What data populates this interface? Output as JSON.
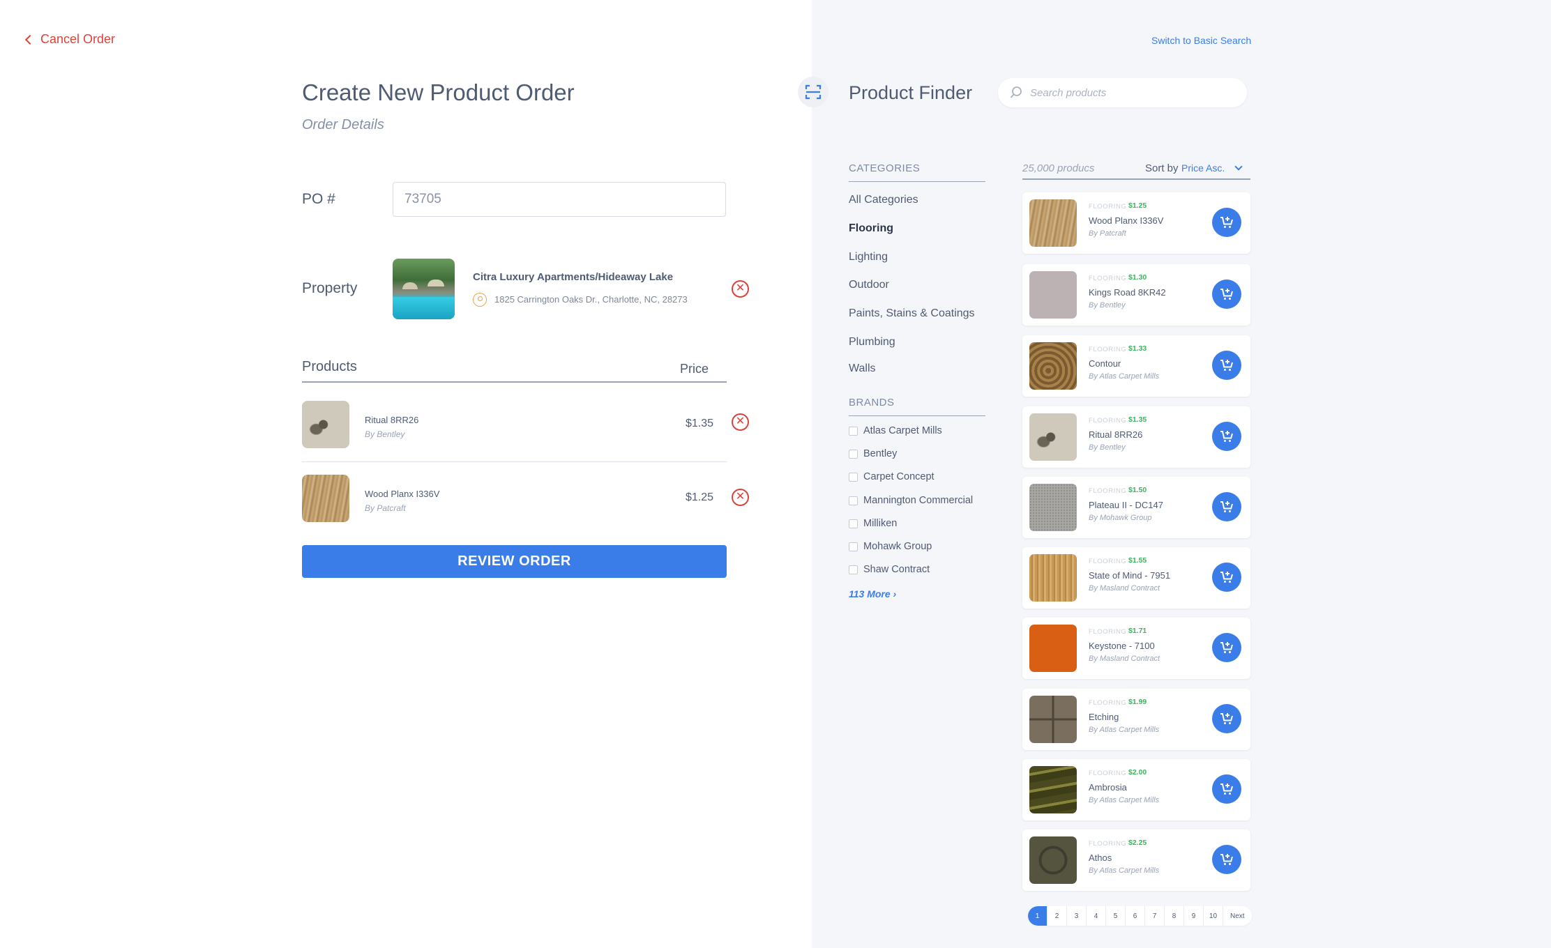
{
  "left": {
    "cancel_label": "Cancel Order",
    "title": "Create New Product Order",
    "subtitle": "Order Details",
    "po_label": "PO #",
    "po_value": "73705",
    "property_label": "Property",
    "property_name": "Citra Luxury Apartments/Hideaway Lake",
    "property_address": "1825 Carrington Oaks Dr., Charlotte, NC, 28273",
    "products_header": "Products",
    "price_header": "Price",
    "order_items": [
      {
        "name": "Ritual 8RR26",
        "by": "By Bentley",
        "price": "$1.35"
      },
      {
        "name": "Wood Planx I336V",
        "by": "By Patcraft",
        "price": "$1.25"
      }
    ],
    "review_label": "REVIEW ORDER"
  },
  "right": {
    "switch_label": "Switch to Basic Search",
    "finder_title": "Product Finder",
    "search_placeholder": "Search products",
    "categories_title": "CATEGORIES",
    "categories": [
      "All Categories",
      "Flooring",
      "Lighting",
      "Outdoor",
      "Paints, Stains & Coatings",
      "Plumbing",
      "Walls"
    ],
    "active_category": "Flooring",
    "brands_title": "BRANDS",
    "brands": [
      "Atlas Carpet Mills",
      "Bentley",
      "Carpet Concept",
      "Mannington Commercial",
      "Milliken",
      "Mohawk Group",
      "Shaw Contract"
    ],
    "more_label": "113 More  ›",
    "count_label": "25,000 producs",
    "sort_label": "Sort by",
    "sort_value": "Price Asc.",
    "products": [
      {
        "category": "FLOORING",
        "price": "$1.25",
        "name": "Wood Planx I336V",
        "by": "By Patcraft"
      },
      {
        "category": "FLOORING",
        "price": "$1.30",
        "name": "Kings Road 8KR42",
        "by": "By Bentley"
      },
      {
        "category": "FLOORING",
        "price": "$1.33",
        "name": "Contour",
        "by": "By Atlas Carpet Mills"
      },
      {
        "category": "FLOORING",
        "price": "$1.35",
        "name": "Ritual 8RR26",
        "by": "By Bentley"
      },
      {
        "category": "FLOORING",
        "price": "$1.50",
        "name": "Plateau II - DC147",
        "by": "By Mohawk Group"
      },
      {
        "category": "FLOORING",
        "price": "$1.55",
        "name": "State of Mind - 7951",
        "by": "By Masland Contract"
      },
      {
        "category": "FLOORING",
        "price": "$1.71",
        "name": "Keystone - 7100",
        "by": "By Masland Contract"
      },
      {
        "category": "FLOORING",
        "price": "$1.99",
        "name": "Etching",
        "by": "By Atlas Carpet Mills"
      },
      {
        "category": "FLOORING",
        "price": "$2.00",
        "name": "Ambrosia",
        "by": "By Atlas Carpet Mills"
      },
      {
        "category": "FLOORING",
        "price": "$2.25",
        "name": "Athos",
        "by": "By Atlas Carpet Mills"
      }
    ],
    "pages": [
      "1",
      "2",
      "3",
      "4",
      "5",
      "6",
      "7",
      "8",
      "9",
      "10"
    ],
    "current_page": "1",
    "next_label": "Next"
  },
  "colors": {
    "accent": "#3b7de8",
    "danger": "#d9443a",
    "price_green": "#3ab65b",
    "text": "#4f5b73",
    "panel_bg": "#f5f6f9"
  }
}
